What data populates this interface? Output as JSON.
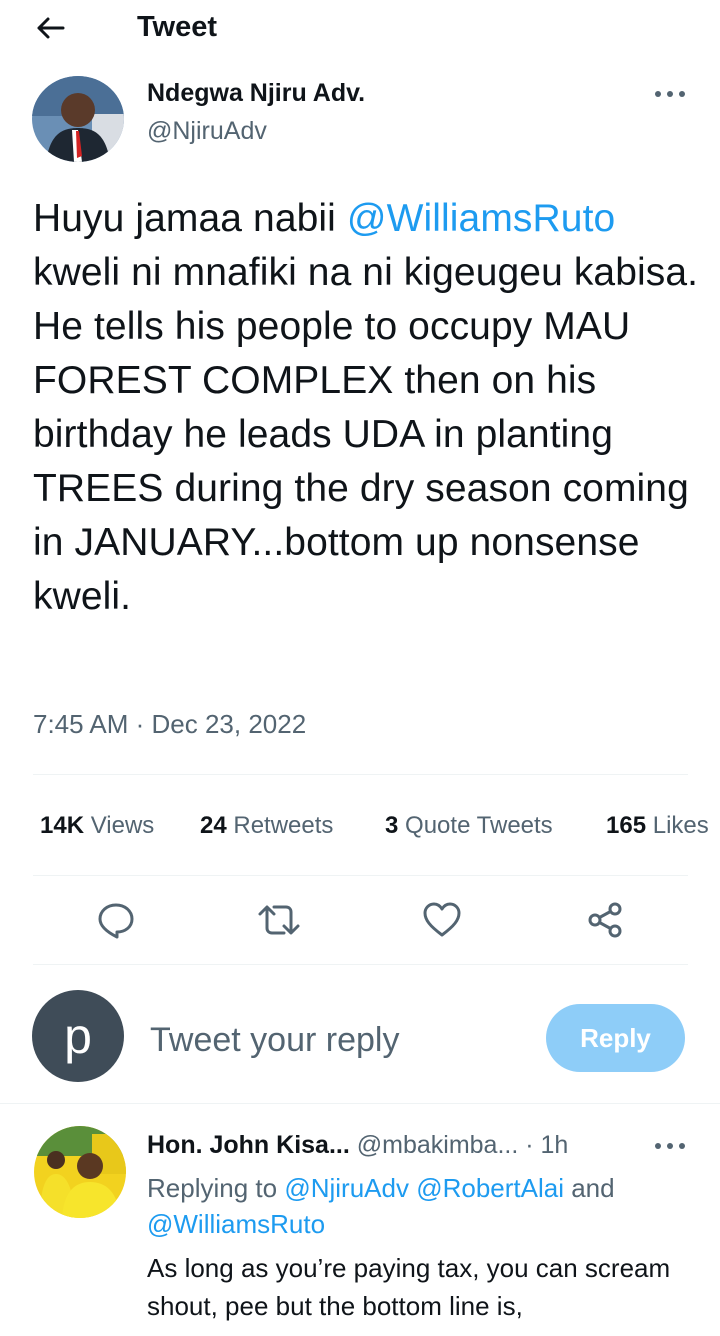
{
  "header": {
    "title": "Tweet",
    "back_icon": "arrow-left-icon"
  },
  "tweet": {
    "author_name": "Ndegwa Njiru Adv.",
    "author_handle": "@NjiruAdv",
    "text_intro": "Huyu jamaa nabii ",
    "mention": "@WilliamsRuto",
    "text_body": " kweli ni mnafiki na ni kigeugeu kabisa. He tells his people to occupy MAU FOREST COMPLEX then on his birthday he leads UDA in planting TREES during the dry season coming in JANUARY...bottom up nonsense kweli.",
    "timestamp": "7:45 AM · Dec 23, 2022"
  },
  "stats": {
    "views_count": "14K",
    "views_label": "Views",
    "retweets_count": "24",
    "retweets_label": "Retweets",
    "quotes_count": "3",
    "quotes_label": "Quote Tweets",
    "likes_count": "165",
    "likes_label": "Likes"
  },
  "actions": [
    "reply-icon",
    "retweet-icon",
    "like-icon",
    "share-icon"
  ],
  "reply_box": {
    "avatar_letter": "p",
    "placeholder": "Tweet your reply",
    "button_label": "Reply",
    "button_color": "#8ecdf8"
  },
  "comment": {
    "name": "Hon. John Kisa...",
    "handle": "@mbakimba...",
    "time": "· 1h",
    "replying_prefix": "Replying to ",
    "mention_1": "@NjiruAdv",
    "mention_2": "@RobertAlai",
    "replying_and": " and ",
    "mention_3": "@WilliamsRuto",
    "text": "As long as you’re paying tax, you can scream shout, pee  but the bottom line is,"
  },
  "colors": {
    "accent": "#1d9bf0",
    "text": "#0f1419",
    "secondary": "#536471",
    "divider": "#eff3f4"
  }
}
